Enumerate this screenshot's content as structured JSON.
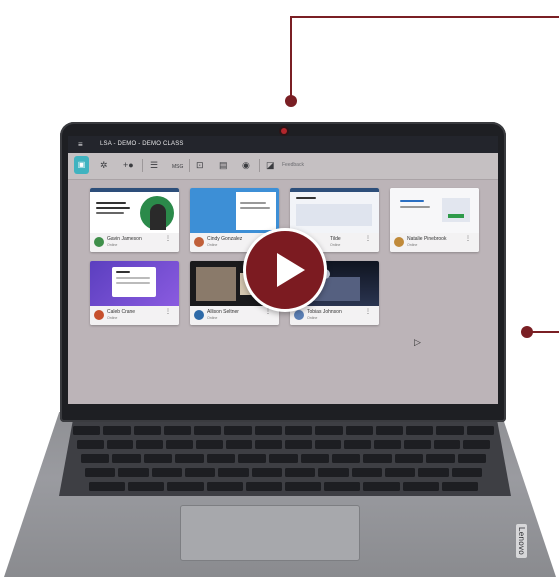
{
  "app": {
    "title": "LSA - DEMO - DEMO CLASS",
    "menu_icon": "hamburger-menu-icon"
  },
  "toolbar": {
    "items": [
      {
        "icon": "screen-view-icon",
        "active": true
      },
      {
        "icon": "settings-icon"
      },
      {
        "icon": "add-user-icon"
      },
      {
        "icon": "list-icon"
      },
      {
        "icon": "message-icon",
        "label": "MSG"
      },
      {
        "icon": "lock-screen-icon"
      },
      {
        "icon": "share-screen-icon"
      },
      {
        "icon": "globe-icon"
      },
      {
        "icon": "thumbnail-icon"
      }
    ],
    "text_label": "Feedback"
  },
  "students": [
    {
      "name": "Gavin Jameson",
      "status": "Online",
      "avatar_color": "#3f8f4a"
    },
    {
      "name": "Cindy Gonzalez",
      "status": "Online",
      "avatar_color": "#c0603a"
    },
    {
      "name": "Tilde",
      "status": "Online",
      "avatar_color": "#4a4a8a"
    },
    {
      "name": "Natalie Pinebrook",
      "status": "Online",
      "avatar_color": "#c08a3a"
    },
    {
      "name": "Caleb Crane",
      "status": "Online",
      "avatar_color": "#c64f2c"
    },
    {
      "name": "Allison Seltner",
      "status": "Online",
      "avatar_color": "#2e6aa8"
    },
    {
      "name": "Tobias Johnson",
      "status": "Online",
      "avatar_color": "#5a7fb5"
    }
  ],
  "play_button": {
    "icon": "play-icon"
  },
  "brand": "Lenovo",
  "colors": {
    "accent": "#7c1b21",
    "active_tool": "#40b3c0",
    "appbar": "#23252c"
  }
}
